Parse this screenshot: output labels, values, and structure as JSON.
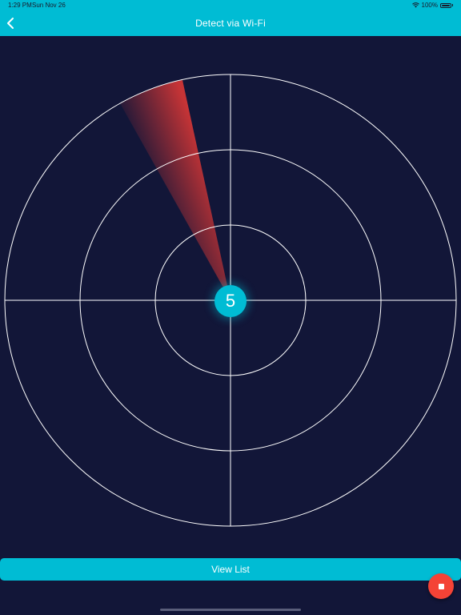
{
  "status_bar": {
    "time": "1:29 PM",
    "date": "Sun Nov 26",
    "battery": "100%"
  },
  "header": {
    "title": "Detect via Wi-Fi",
    "back_icon": "chevron-left-icon"
  },
  "radar": {
    "device_count": "5",
    "sweep_color": "#e53935",
    "ring_color": "#ffffff"
  },
  "actions": {
    "view_list_label": "View List",
    "stop_icon": "stop-icon",
    "stop_color": "#f44336"
  },
  "colors": {
    "accent": "#00bcd4",
    "background": "#121638"
  }
}
